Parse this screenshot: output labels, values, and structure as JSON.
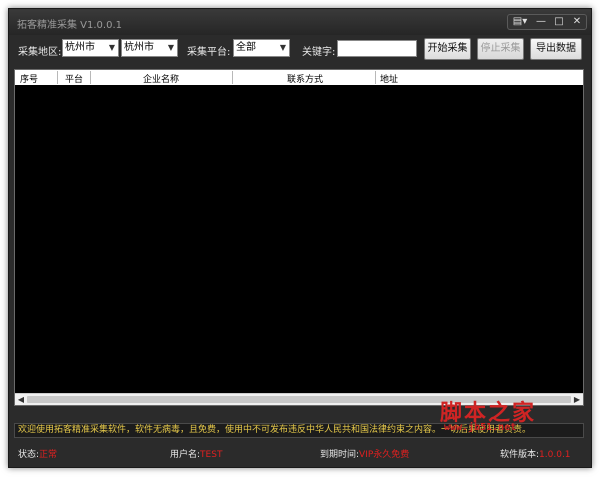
{
  "window": {
    "title": "拓客精准采集 V1.0.0.1"
  },
  "titlebar": {
    "menu_icon": "menu-icon",
    "minimize": "—",
    "maximize": "□",
    "close": "✕"
  },
  "filters": {
    "area_label": "采集地区:",
    "province": "杭州市",
    "city": "杭州市",
    "platform_label": "采集平台:",
    "platform": "全部",
    "keyword_label": "关键字:",
    "keyword_value": ""
  },
  "buttons": {
    "start": "开始采集",
    "stop": "停止采集",
    "export": "导出数据"
  },
  "table": {
    "columns": [
      "序号",
      "平台",
      "企业名称",
      "联系方式",
      "地址"
    ]
  },
  "notice": "欢迎使用拓客精准采集软件，软件无病毒，且免费，使用中不可发布违反中华人民共和国法律约束之内容。一切后果使用者负责。",
  "status": {
    "state_label": "状态:",
    "state_value": "正常",
    "user_label": "用户名:",
    "user_value": "TEST",
    "expire_label": "到期时间:",
    "expire_value": "VIP永久免费",
    "version_label": "软件版本:",
    "version_value": "1.0.0.1"
  },
  "watermark": {
    "text": "脚本之家",
    "url": "www.jb51.net"
  },
  "colors": {
    "window_bg": "#2b2b2b",
    "grid_bg": "#000000",
    "notice_text": "#e6c94a",
    "status_value": "#e02020"
  }
}
